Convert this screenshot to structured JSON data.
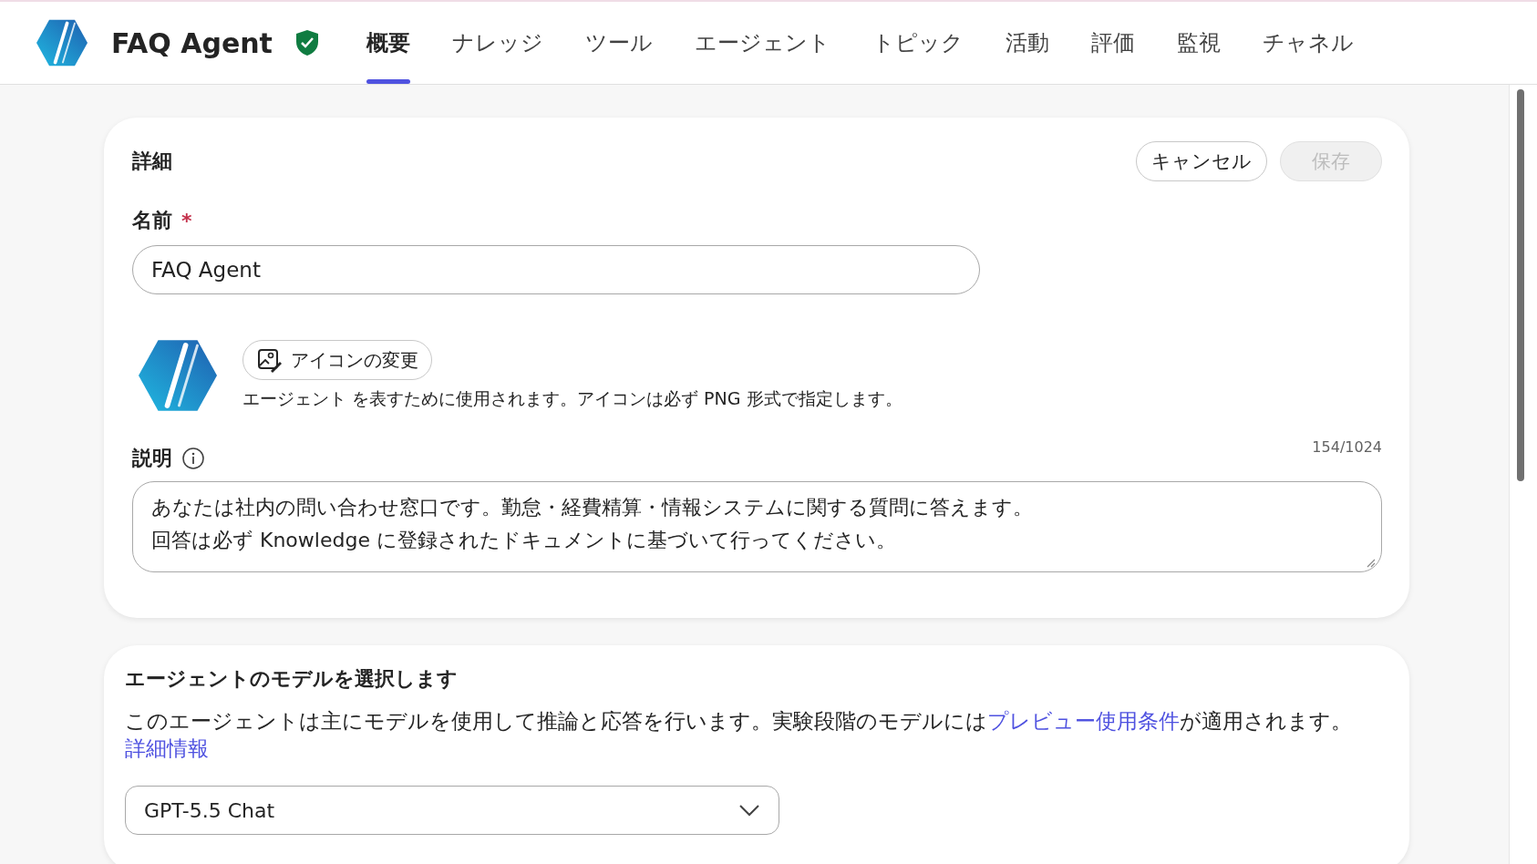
{
  "header": {
    "title": "FAQ Agent",
    "tabs": [
      {
        "label": "概要",
        "selected": true
      },
      {
        "label": "ナレッジ",
        "selected": false
      },
      {
        "label": "ツール",
        "selected": false
      },
      {
        "label": "エージェント",
        "selected": false
      },
      {
        "label": "トピック",
        "selected": false
      },
      {
        "label": "活動",
        "selected": false
      },
      {
        "label": "評価",
        "selected": false
      },
      {
        "label": "監視",
        "selected": false
      },
      {
        "label": "チャネル",
        "selected": false
      }
    ]
  },
  "details": {
    "heading": "詳細",
    "buttons": [
      {
        "label": "キャンセル",
        "disabled": false
      },
      {
        "label": "保存",
        "disabled": true
      }
    ],
    "name_label": "名前",
    "required_mark": "*",
    "name_value": "FAQ Agent",
    "change_icon_button": "アイコンの変更",
    "icon_hint": "エージェント を表すために使用されます。アイコンは必ず PNG 形式で指定します。",
    "description_label": "説明",
    "counter": "154/1024",
    "description_lines": [
      "あなたは社内の問い合わせ窓口です。勤怠・経費精算・情報システムに関する質問に答えます。",
      "回答は必ず Knowledge に登録されたドキュメントに基づいて行ってください。"
    ]
  },
  "model": {
    "heading": "エージェントのモデルを選択します",
    "text_before": "このエージェントは主にモデルを使用して推論と応答を行います。実験段階のモデルには",
    "link": "プレビュー使用条件",
    "text_after": "が適用されます。",
    "more_link": "詳細情報",
    "selected_model": "GPT-5.5 Chat"
  }
}
